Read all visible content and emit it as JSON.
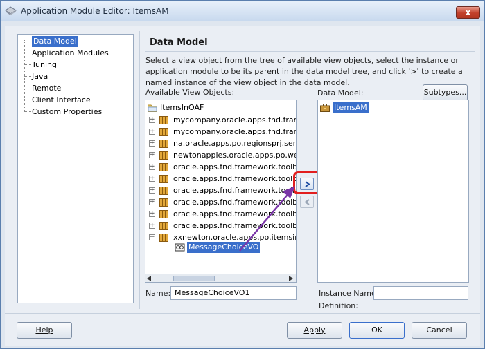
{
  "window": {
    "title": "Application Module Editor: ItemsAM",
    "close_glyph": "x"
  },
  "nav": {
    "items": [
      {
        "label": "Data Model",
        "selected": true
      },
      {
        "label": "Application Modules"
      },
      {
        "label": "Tuning"
      },
      {
        "label": "Java"
      },
      {
        "label": "Remote"
      },
      {
        "label": "Client Interface"
      },
      {
        "label": "Custom Properties"
      }
    ]
  },
  "panel": {
    "title": "Data Model",
    "description": "Select a view object from the tree of available view objects, select the instance or application module to be its parent in the data model tree, and click '>' to create a named instance of the view object in the data model.",
    "available_label": "Available View Objects:",
    "data_model_label": "Data Model:",
    "subtypes_button": "Subtypes..."
  },
  "available_tree": {
    "root": "ItemsInOAF",
    "packages": [
      "mycompany.oracle.apps.fnd.framework",
      "mycompany.oracle.apps.fnd.framework",
      "na.oracle.apps.po.regionsprj.server",
      "newtonapples.oracle.apps.po.welcome",
      "oracle.apps.fnd.framework.toolbox.",
      "oracle.apps.fnd.framework.toolbox.",
      "oracle.apps.fnd.framework.toolbox.",
      "oracle.apps.fnd.framework.toolbox.",
      "oracle.apps.fnd.framework.toolbox.",
      "oracle.apps.fnd.framework.toolbox.",
      "xxnewton.oracle.apps.po.itemsinoaf"
    ],
    "selected_vo": "MessageChoiceVO"
  },
  "name_field": {
    "label": "Name:",
    "value": "MessageChoiceVO1"
  },
  "data_model_tree": {
    "root": "ItemsAM"
  },
  "instance_name": {
    "label": "Instance Name:",
    "value": ""
  },
  "definition_label": "Definition:",
  "shuttle": {
    "add": ">",
    "remove": "<"
  },
  "footer": {
    "help": "Help",
    "apply": "Apply",
    "ok": "OK",
    "cancel": "Cancel"
  },
  "colors": {
    "selection": "#3a6fcb",
    "highlight": "#e21e1e",
    "arrow": "#7a35a8"
  }
}
